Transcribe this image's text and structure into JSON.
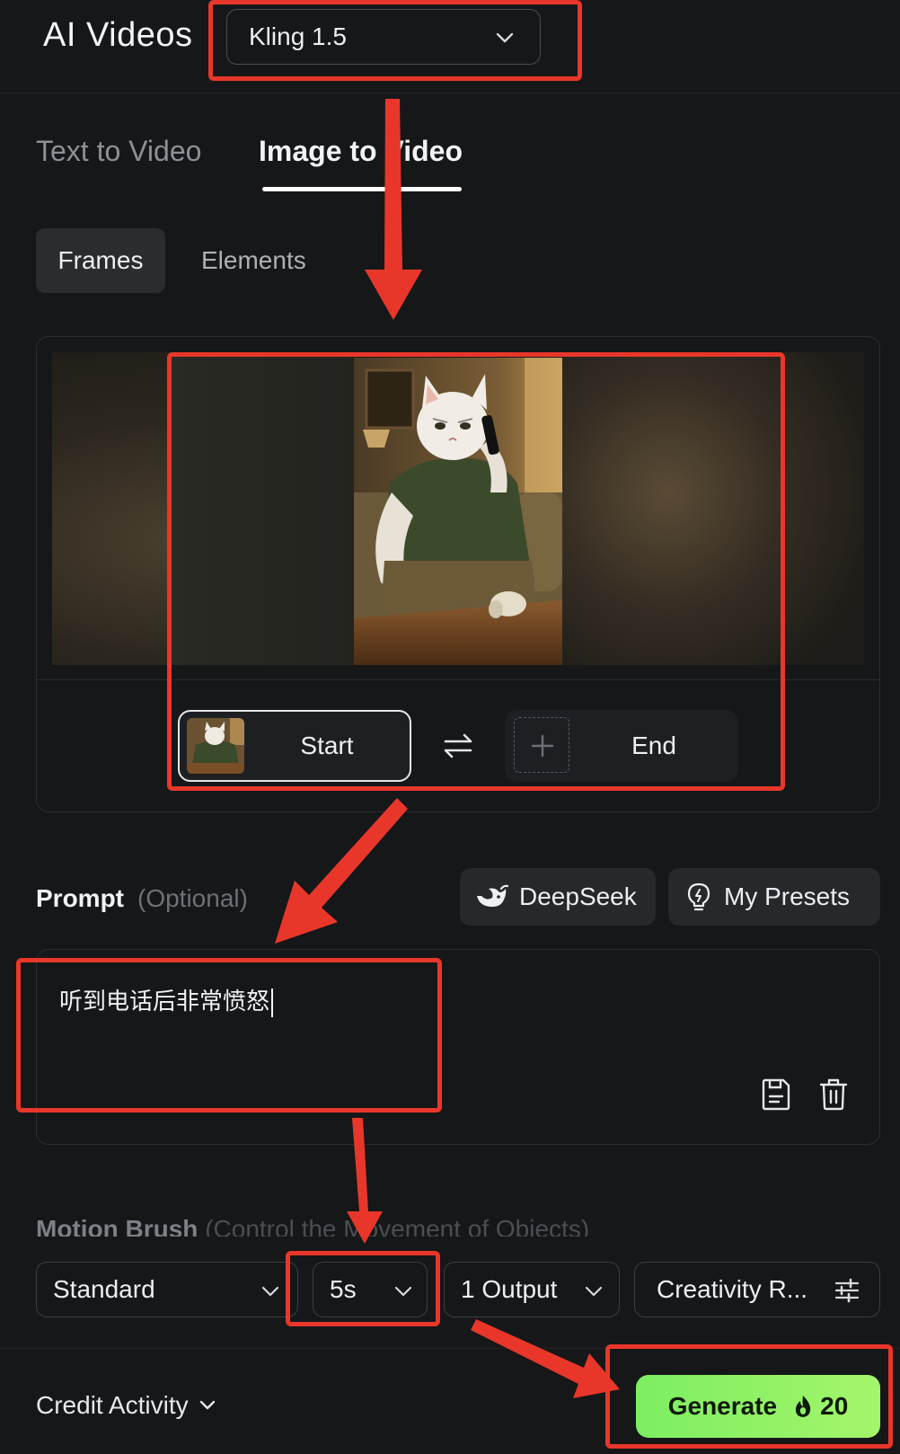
{
  "header": {
    "title": "AI Videos",
    "model": "Kling 1.5"
  },
  "tabs": [
    {
      "label": "Text to Video",
      "active": false
    },
    {
      "label": "Image to Video",
      "active": true
    }
  ],
  "subtabs": [
    {
      "label": "Frames",
      "active": true
    },
    {
      "label": "Elements",
      "active": false
    }
  ],
  "frames": {
    "start_label": "Start",
    "end_label": "End"
  },
  "prompt": {
    "label": "Prompt",
    "optional": "(Optional)",
    "deepseek_label": "DeepSeek",
    "presets_label": "My Presets",
    "value": "听到电话后非常愤怒"
  },
  "motion_brush": {
    "title": "Motion Brush",
    "subtitle": "(Control the Movement of Objects)"
  },
  "settings": {
    "mode": "Standard",
    "duration": "5s",
    "outputs": "1 Output",
    "creativity": "Creativity R..."
  },
  "footer": {
    "credit_activity": "Credit Activity",
    "generate_label": "Generate",
    "generate_cost": "20"
  },
  "colors": {
    "background": "#161719",
    "accent_green": "#8ef165",
    "annotation_red": "#e8372a"
  },
  "icons": [
    "chevron-down-icon",
    "swap-icon",
    "plus-icon",
    "deepseek-whale-icon",
    "lightbulb-icon",
    "save-icon",
    "trash-icon",
    "sliders-icon",
    "flame-icon"
  ]
}
